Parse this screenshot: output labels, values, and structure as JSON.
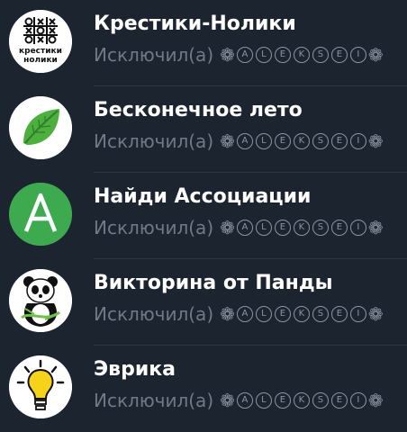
{
  "chats": [
    {
      "title": "Крестики-Нолики",
      "subtitle": "Исключил(а)",
      "avatar_icon": "tic-tac-toe-icon",
      "avatar_text": "крестики\nнолики"
    },
    {
      "title": "Бесконечное лето",
      "subtitle": "Исключил(а)",
      "avatar_icon": "leaf-icon"
    },
    {
      "title": "Найди Ассоциации",
      "subtitle": "Исключил(а)",
      "avatar_icon": "letter-a-icon"
    },
    {
      "title": "Викторина от Панды",
      "subtitle": "Исключил(а)",
      "avatar_icon": "panda-icon"
    },
    {
      "title": "Эврика",
      "subtitle": "Исключил(а)",
      "avatar_icon": "lightbulb-icon"
    }
  ],
  "user_name_letters": [
    "A",
    "L",
    "E",
    "K",
    "S",
    "E",
    "I"
  ],
  "user_name_flower": "❁",
  "colors": {
    "background": "#1c2430",
    "title": "#ffffff",
    "subtitle": "#6f7a89",
    "divider": "#2d3744",
    "green_accent": "#3daa50"
  }
}
